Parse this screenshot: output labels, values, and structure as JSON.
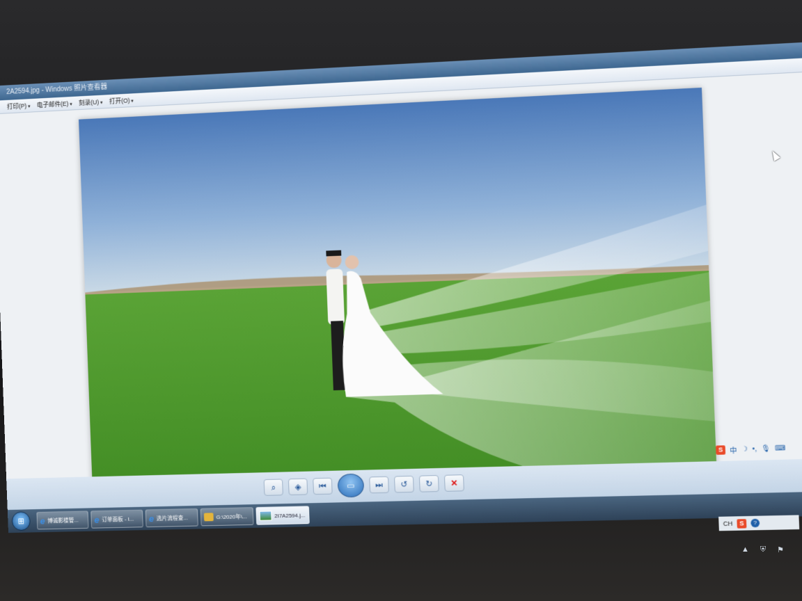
{
  "window": {
    "title": "2A2594.jpg - Windows 照片查看器"
  },
  "menu": {
    "items": [
      "打印(P)",
      "电子邮件(E)",
      "刻录(U)",
      "打开(O)"
    ]
  },
  "viewer_toolbar": {
    "buttons": [
      "zoom-icon",
      "fit-icon",
      "previous-icon",
      "slideshow-icon",
      "next-icon",
      "rotate-ccw-icon",
      "rotate-cw-icon",
      "delete-icon"
    ]
  },
  "taskbar": {
    "items": [
      {
        "label": "博诚影楼管...",
        "icon": "ie-icon"
      },
      {
        "label": "订单面板 - I...",
        "icon": "ie-icon"
      },
      {
        "label": "选片流程查...",
        "icon": "ie-icon"
      },
      {
        "label": "G:\\2020年\\...",
        "icon": "folder-icon"
      },
      {
        "label": "2I7A2594.j...",
        "icon": "image-icon",
        "active": true
      }
    ]
  },
  "ime": {
    "logo": "S",
    "mode": "中",
    "moon": "☽",
    "dot": "•,",
    "mic": "🎙",
    "keyboard": "⌨"
  },
  "tray": {
    "lang": "CH",
    "sogou": "S",
    "help": "?"
  },
  "colors": {
    "sky_top": "#4a78b8",
    "grass": "#4f9e2a",
    "taskbar": "#2e4258",
    "sogou": "#e94b2a"
  }
}
